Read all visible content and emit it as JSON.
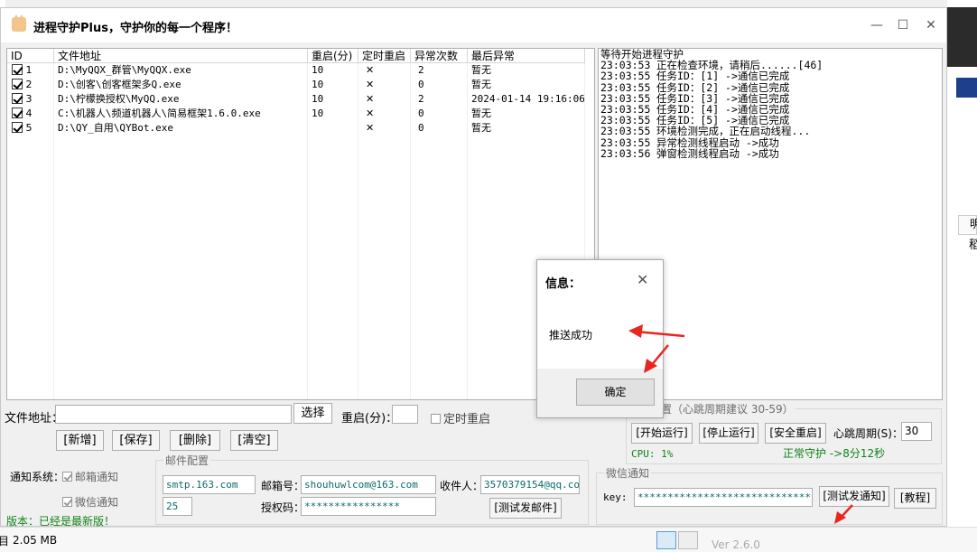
{
  "window": {
    "title": "进程守护Plus，守护你的每一个程序！",
    "minimize": "—",
    "maximize": "☐",
    "close": "✕"
  },
  "table": {
    "headers": [
      "ID",
      "文件地址",
      "重启(分)",
      "定时重启",
      "异常次数",
      "最后异常"
    ],
    "rows": [
      {
        "checked": true,
        "id": "1",
        "path": "D:\\MyQQX_群管\\MyQQX.exe",
        "restart": "10",
        "timed": "✕",
        "count": "2",
        "last": "暂无"
      },
      {
        "checked": true,
        "id": "2",
        "path": "D:\\创客\\创客框架多Q.exe",
        "restart": "10",
        "timed": "✕",
        "count": "0",
        "last": "暂无"
      },
      {
        "checked": true,
        "id": "3",
        "path": "D:\\柠檬换授权\\MyQQ.exe",
        "restart": "10",
        "timed": "✕",
        "count": "2",
        "last": "2024-01-14 19:16:06"
      },
      {
        "checked": true,
        "id": "4",
        "path": "C:\\机器人\\频道机器人\\简易框架1.6.0.exe",
        "restart": "10",
        "timed": "✕",
        "count": "0",
        "last": "暂无"
      },
      {
        "checked": true,
        "id": "5",
        "path": "D:\\QY_自用\\QYBot.exe",
        "restart": "",
        "timed": "✕",
        "count": "0",
        "last": "暂无"
      }
    ]
  },
  "log": {
    "header": "等待开始进程守护",
    "lines": [
      {
        "time": "23:03:53",
        "text": "正在检查环境，请稍后......[46]"
      },
      {
        "time": "23:03:55",
        "text": "任务ID：[1] ->通信已完成"
      },
      {
        "time": "23:03:55",
        "text": "任务ID：[2] ->通信已完成"
      },
      {
        "time": "23:03:55",
        "text": "任务ID：[3] ->通信已完成"
      },
      {
        "time": "23:03:55",
        "text": "任务ID：[4] ->通信已完成"
      },
      {
        "time": "23:03:55",
        "text": "任务ID：[5] ->通信已完成"
      },
      {
        "time": "23:03:55",
        "text": "环境检测完成，正在启动线程..."
      },
      {
        "time": "23:03:55",
        "text": "异常检测线程启动 ->成功"
      },
      {
        "time": "23:03:56",
        "text": "弹窗检测线程启动 ->成功"
      }
    ]
  },
  "form": {
    "path_label": "文件地址：",
    "path_value": "",
    "choose": "选择",
    "restart_label": "重启(分)：",
    "restart_value": "",
    "timed_label": "定时重启",
    "add": "[新增]",
    "save": "[保存]",
    "delete": "[删除]",
    "clear": "[清空]"
  },
  "notify": {
    "label": "通知系统：",
    "mail": "邮箱通知",
    "wechat": "微信通知",
    "version": "版本：已经是最新版！"
  },
  "mail": {
    "title": "邮件配置",
    "smtp": "smtp.163.com",
    "port": "25",
    "account_label": "邮箱号：",
    "account": "shouhuwlcom@163.com",
    "auth_label": "授权码：",
    "auth": "****************",
    "receiver_label": "收件人：",
    "receiver": "3570379154@qq.com",
    "test": "[测试发邮件]"
  },
  "settings": {
    "title": "置（心跳周期建议 30-59）",
    "start": "[开始运行]",
    "stop": "[停止运行]",
    "safe_restart": "[安全重启]",
    "heartbeat_label": "心跳周期(S)：",
    "heartbeat": "30",
    "cpu": "CPU: 1%",
    "status": "正常守护 ->8分12秒"
  },
  "wechat": {
    "title": "微信通知",
    "key_label": "key:",
    "key": "**********************************",
    "test": "[测试发通知]",
    "tutorial": "[教程]"
  },
  "dialog": {
    "title": "信息：",
    "close": "✕",
    "message": "推送成功",
    "ok": "确定"
  },
  "background": {
    "size": "2.05 MB",
    "glyph": "目",
    "tab_a": "明",
    "tab_b": "稻",
    "version_hint": "Ver 2.6.0"
  },
  "colors": {
    "accent_green": "#12821a",
    "teal_text": "#0b6a6a",
    "annotation_red": "#e8251f"
  }
}
